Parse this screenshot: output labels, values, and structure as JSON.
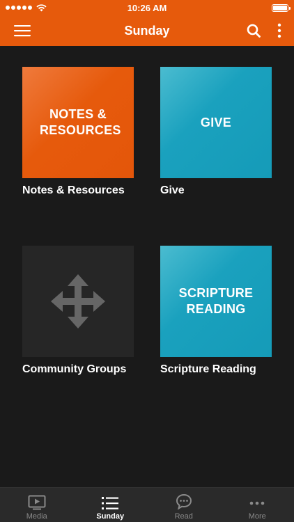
{
  "status_bar": {
    "time": "10:26 AM"
  },
  "header": {
    "title": "Sunday",
    "menu_icon": "hamburger-icon",
    "search_icon": "search-icon",
    "more_icon": "vertical-ellipsis-icon",
    "background_color": "#e65a0c"
  },
  "tiles": [
    {
      "tile_text": "NOTES & RESOURCES",
      "caption": "Notes & Resources",
      "color": "#e65a0c"
    },
    {
      "tile_text": "GIVE",
      "caption": "Give",
      "color": "#1aa1be"
    },
    {
      "tile_text": "",
      "caption": "Community Groups",
      "icon": "move-arrows-icon",
      "color": "#262626"
    },
    {
      "tile_text": "SCRIPTURE READING",
      "caption": "Scripture Reading",
      "color": "#1aa1be"
    }
  ],
  "tab_bar": {
    "tabs": [
      {
        "label": "Media",
        "icon": "play-screen-icon"
      },
      {
        "label": "Sunday",
        "icon": "list-icon",
        "active": true
      },
      {
        "label": "Read",
        "icon": "chat-bubble-icon"
      },
      {
        "label": "More",
        "icon": "horizontal-ellipsis-icon"
      }
    ]
  }
}
